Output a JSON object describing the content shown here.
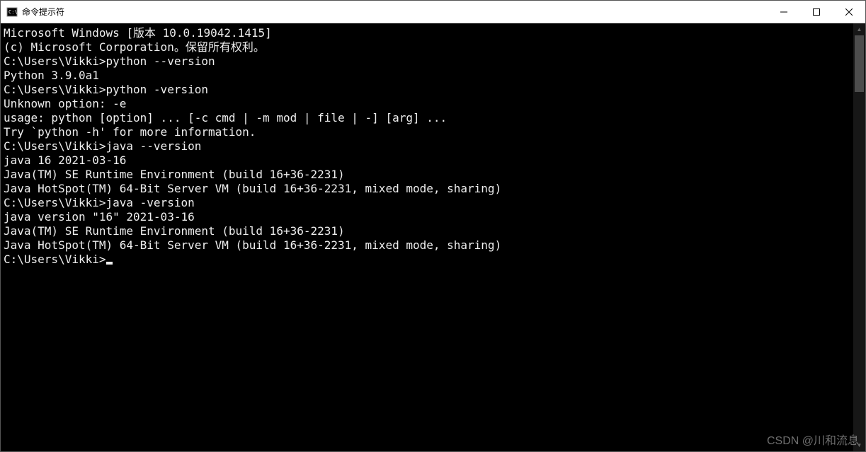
{
  "window": {
    "title": "命令提示符"
  },
  "terminal": {
    "lines": [
      "Microsoft Windows [版本 10.0.19042.1415]",
      "(c) Microsoft Corporation。保留所有权利。",
      "",
      "C:\\Users\\Vikki>python --version",
      "Python 3.9.0a1",
      "",
      "C:\\Users\\Vikki>python -version",
      "Unknown option: -e",
      "usage: python [option] ... [-c cmd | -m mod | file | -] [arg] ...",
      "Try `python -h' for more information.",
      "",
      "C:\\Users\\Vikki>java --version",
      "java 16 2021-03-16",
      "Java(TM) SE Runtime Environment (build 16+36-2231)",
      "Java HotSpot(TM) 64-Bit Server VM (build 16+36-2231, mixed mode, sharing)",
      "",
      "C:\\Users\\Vikki>java -version",
      "java version \"16\" 2021-03-16",
      "Java(TM) SE Runtime Environment (build 16+36-2231)",
      "Java HotSpot(TM) 64-Bit Server VM (build 16+36-2231, mixed mode, sharing)",
      "",
      "C:\\Users\\Vikki>"
    ]
  },
  "watermark": "CSDN @川和流息"
}
